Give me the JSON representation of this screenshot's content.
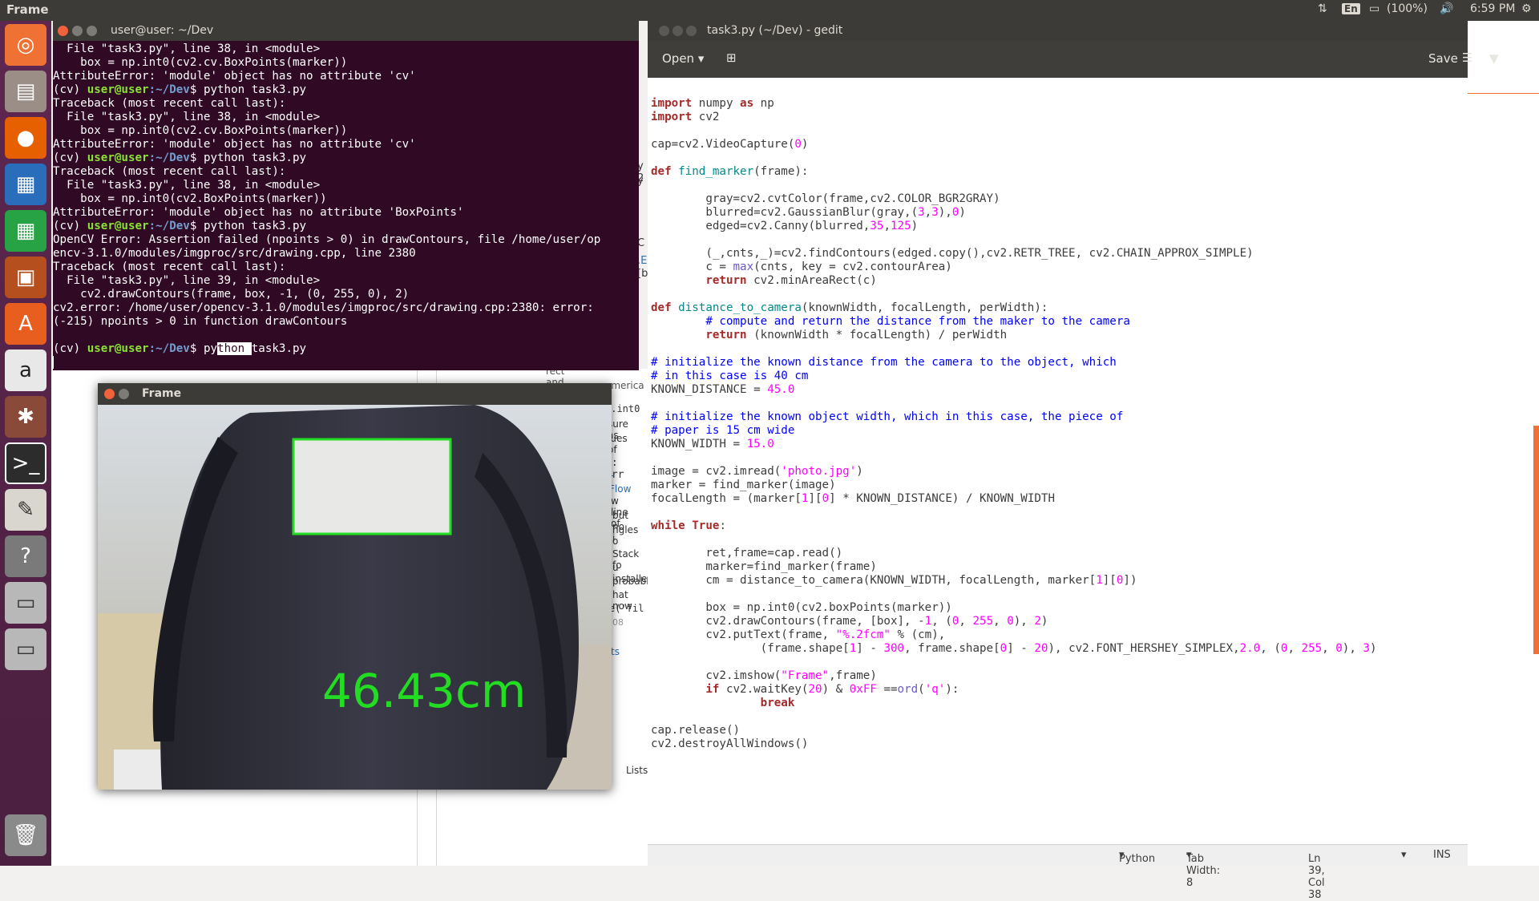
{
  "top_panel": {
    "app_name": "Frame",
    "keyboard_layout": "En",
    "battery": "(100%)",
    "time": "6:59 PM"
  },
  "launcher": {
    "items": [
      "ubuntu-dash-icon",
      "files-icon",
      "firefox-icon",
      "writer-icon",
      "calc-icon",
      "impress-icon",
      "software-center-icon",
      "amazon-icon",
      "system-settings-icon",
      "terminal-icon",
      "text-editor-icon",
      "help-icon",
      "drive-icon",
      "drive-icon",
      "trash-icon"
    ]
  },
  "terminal": {
    "title": "user@user: ~/Dev",
    "prompt_env": "(cv) ",
    "prompt_user": "user@user",
    "prompt_path": ":~/Dev",
    "prompt_symbol": "$ ",
    "lines": [
      "  File \"task3.py\", line 38, in <module>",
      "    box = np.int0(cv2.cv.BoxPoints(marker))",
      "AttributeError: 'module' object has no attribute 'cv'",
      "PROMPT python task3.py",
      "Traceback (most recent call last):",
      "  File \"task3.py\", line 38, in <module>",
      "    box = np.int0(cv2.cv.BoxPoints(marker))",
      "AttributeError: 'module' object has no attribute 'cv'",
      "PROMPT python task3.py",
      "Traceback (most recent call last):",
      "  File \"task3.py\", line 38, in <module>",
      "    box = np.int0(cv2.BoxPoints(marker))",
      "AttributeError: 'module' object has no attribute 'BoxPoints'",
      "PROMPT python task3.py",
      "OpenCV Error: Assertion failed (npoints > 0) in drawContours, file /home/user/op",
      "encv-3.1.0/modules/imgproc/src/drawing.cpp, line 2380",
      "Traceback (most recent call last):",
      "  File \"task3.py\", line 39, in <module>",
      "    cv2.drawContours(frame, box, -1, (0, 255, 0), 2)",
      "cv2.error: /home/user/opencv-3.1.0/modules/imgproc/src/drawing.cpp:2380: error:",
      "(-215) npoints > 0 in function drawContours",
      ""
    ],
    "last_cmd_pre": "py",
    "last_cmd_sel": "thon ",
    "last_cmd_post": "task3.py"
  },
  "gedit": {
    "title": "task3.py (~/Dev) - gedit",
    "open_label": "Open",
    "save_label": "Save",
    "status": {
      "language": "Python",
      "tab_width": "Tab Width: 8",
      "position": "Ln 39, Col 38",
      "mode": "INS"
    },
    "code": [
      "import numpy as np",
      "import cv2",
      "",
      "cap=cv2.VideoCapture(0)",
      "",
      "def find_marker(frame):",
      "",
      "        gray=cv2.cvtColor(frame,cv2.COLOR_BGR2GRAY)",
      "        blurred=cv2.GaussianBlur(gray,(3,3),0)",
      "        edged=cv2.Canny(blurred,35,125)",
      "",
      "        (_,cnts,_)=cv2.findContours(edged.copy(),cv2.RETR_TREE, cv2.CHAIN_APPROX_SIMPLE)",
      "        c = max(cnts, key = cv2.contourArea)",
      "        return cv2.minAreaRect(c)",
      "",
      "def distance_to_camera(knownWidth, focalLength, perWidth):",
      "        # compute and return the distance from the maker to the camera",
      "        return (knownWidth * focalLength) / perWidth",
      "",
      "# initialize the known distance from the camera to the object, which",
      "# in this case is 40 cm",
      "KNOWN_DISTANCE = 45.0",
      "",
      "# initialize the known object width, which in this case, the piece of",
      "# paper is 15 cm wide",
      "KNOWN_WIDTH = 15.0",
      "",
      "image = cv2.imread('photo.jpg')",
      "marker = find_marker(image)",
      "focalLength = (marker[1][0] * KNOWN_DISTANCE) / KNOWN_WIDTH",
      "",
      "while True:",
      "",
      "        ret,frame=cap.read()",
      "        marker=find_marker(frame)",
      "        cm = distance_to_camera(KNOWN_WIDTH, focalLength, marker[1][0])",
      "",
      "        box = np.int0(cv2.boxPoints(marker))",
      "        cv2.drawContours(frame, [box], -1, (0, 255, 0), 2)",
      "        cv2.putText(frame, \"%.2fcm\" % (cm),",
      "                (frame.shape[1] - 300, frame.shape[0] - 20), cv2.FONT_HERSHEY_SIMPLEX,2.0, (0, 255, 0), 3)",
      "",
      "        cv2.imshow(\"Frame\",frame)",
      "        if cv2.waitKey(20) & 0xFF ==ord('q'):",
      "                break",
      "",
      "cap.release()",
      "cv2.destroyAllWindows()"
    ]
  },
  "frame_window": {
    "title": "Frame",
    "distance_text": "46.43cm",
    "box_color": "#22dd22"
  },
  "background_fragments": [
    "y 2",
    "y",
    "ct",
    "C",
    "ct",
    ".E",
    "[b",
    "rect and box lines",
    "america",
    "p.int0",
    "sure as",
    "lues of",
    "]: arr",
    "r Flow",
    "w line of",
    "but no i",
    "ngles o",
    "Stack fo",
    "u installe",
    "probably",
    "hat now",
    "e('fil",
    "08",
    "ts",
    "Lists"
  ]
}
